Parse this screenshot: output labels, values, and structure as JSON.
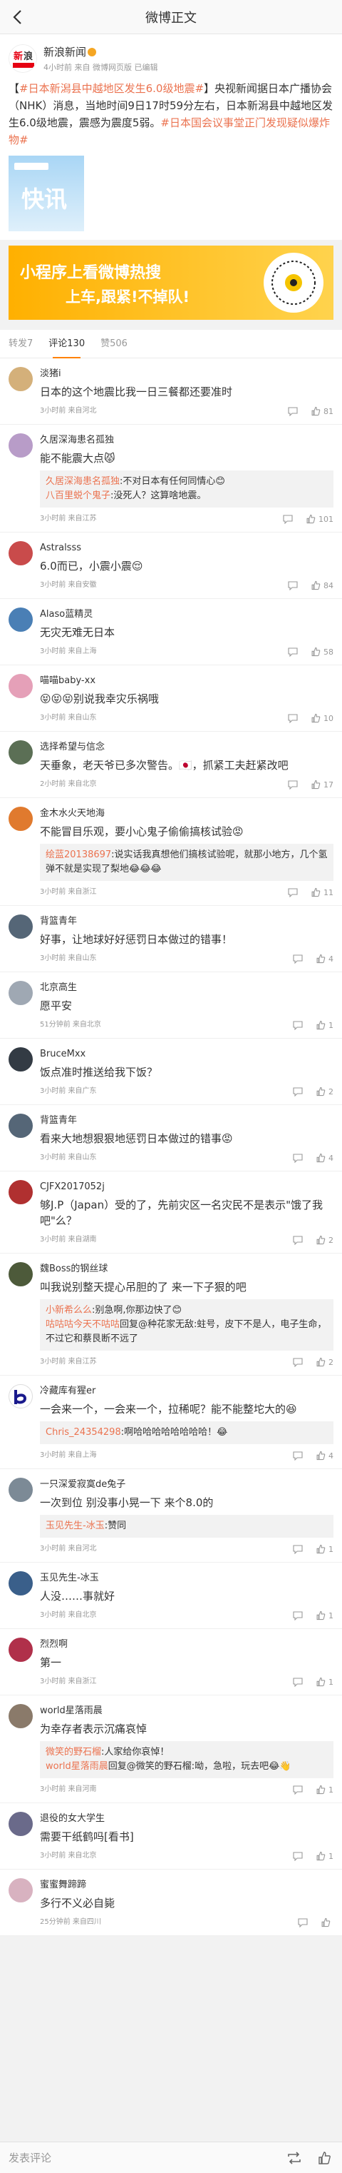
{
  "nav": {
    "title": "微博正文"
  },
  "post": {
    "author": "新浪新闻",
    "meta": "4小时前 来自 微博网页版 已编辑",
    "topic1": "#日本新潟县中越地区发生6.0级地震#",
    "text1": "央视新闻据日本广播协会（NHK）消息，当地时间9日17时59分左右，日本新潟县中越地区发生6.0级地震，震感为震度5弱。",
    "topic2": "#日本国会议事堂正门发现疑似爆炸物#",
    "image_label": "快讯"
  },
  "banner": {
    "line1": "小程序上看微博热搜",
    "line2": "上车,跟紧!不掉队!"
  },
  "tabs": [
    {
      "label": "转发7"
    },
    {
      "label": "评论130"
    },
    {
      "label": "赞506"
    }
  ],
  "comments": [
    {
      "name": "淡猪i",
      "text": "日本的这个地震比我一日三餐都还要准时",
      "meta": "3小时前 来自河北",
      "likes": "81",
      "avatar": "#d4b07a"
    },
    {
      "name": "久居深海患名孤独",
      "text": "能不能震大点😾",
      "reply_user": "久居深海患名孤独",
      "reply_text": ":不对日本有任何同情心😊",
      "reply2_user": "八百里蜕个鬼子",
      "reply2_text": ":没死人？这算啥地震。",
      "meta": "3小时前 来自江苏",
      "likes": "101",
      "avatar": "#b89cc8"
    },
    {
      "name": "Astralsss",
      "text": "6.0而已，小震小震😌",
      "meta": "3小时前 来自安徽",
      "likes": "84",
      "avatar": "#c94b4b"
    },
    {
      "name": "Alaso蓝精灵",
      "text": "无灾无难无日本",
      "meta": "3小时前 来自上海",
      "likes": "58",
      "avatar": "#4a7fb5"
    },
    {
      "name": "喵喵baby-xx",
      "text": "😝😝😝别说我幸灾乐祸哦",
      "meta": "3小时前 来自山东",
      "likes": "10",
      "avatar": "#e5a0b8"
    },
    {
      "name": "选择希望与信念",
      "text": "天垂象，老天爷已多次警告。🇯🇵，抓紧工夫赶紧改吧",
      "meta": "2小时前 来自北京",
      "likes": "17",
      "avatar": "#5b6f55"
    },
    {
      "name": "金木水火天地海",
      "text": "不能冒目乐观，要小心鬼子偷偷搞核试验😡",
      "reply_user": "绘蓝20138697",
      "reply_text": ":说实话我真想他们搞核试验呢，就那小地方，几个氢弹不就是实现了梨地😂😂😂",
      "meta": "3小时前 来自浙江",
      "likes": "11",
      "avatar": "#e07a2e"
    },
    {
      "name": "背篮青年",
      "text": "好事，让地球好好惩罚日本做过的错事！",
      "meta": "3小时前 来自山东",
      "likes": "4",
      "avatar": "#556677"
    },
    {
      "name": "北京高生",
      "text": "愿平安",
      "meta": "51分钟前 来自北京",
      "likes": "1",
      "avatar": "#9fa8b3"
    },
    {
      "name": "BruceMxx",
      "text": "饭点准时推送给我下饭？",
      "meta": "3小时前 来自广东",
      "likes": "2",
      "avatar": "#333b44"
    },
    {
      "name": "背篮青年",
      "text": "看来大地想狠狠地惩罚日本做过的错事😡",
      "meta": "3小时前 来自山东",
      "likes": "4",
      "avatar": "#556677"
    },
    {
      "name": "CJFX2017052j",
      "text": "够J.P（Japan）受的了，先前灾区一名灾民不是表示\"饿了我吧\"么？",
      "meta": "3小时前 来自湖南",
      "likes": "2",
      "avatar": "#b03030"
    },
    {
      "name": "魏Boss的钢丝球",
      "text": "叫我说别整天提心吊胆的了 来一下子狠的吧",
      "reply_user": "小新希么么",
      "reply_text": ":别急啊,你那边快了😊",
      "reply2_user": "咕咕咕今天不咕咕",
      "reply2_text": "回复@种花家无敌:蛀号，皮下不是人，电子生命，不过它和蔡艮断不远了",
      "meta": "3小时前 来自江苏",
      "likes": "2",
      "avatar": "#4d5a3a"
    },
    {
      "name": "冷藏库有猩er",
      "text": "一会来一个，一会来一个，拉稀呢？能不能整坨大的😆",
      "reply_user": "Chris_24354298",
      "reply_text": ":啊哈哈哈哈哈哈哈哈！😂",
      "meta": "3小时前 来自上海",
      "likes": "4",
      "avatar": "#ffffff"
    },
    {
      "name": "一只深爱寂寞de兔子",
      "text": "一次到位 别没事小晃一下 来个8.0的",
      "reply_user": "玉见先生-冰玉",
      "reply_text": ":赞同",
      "meta": "3小时前 来自河北",
      "likes": "1",
      "avatar": "#7c8a96"
    },
    {
      "name": "玉见先生-冰玉",
      "text": "人没……事就好",
      "meta": "3小时前 来自北京",
      "likes": "1",
      "avatar": "#3a5f8a"
    },
    {
      "name": "烈烈啊",
      "text": "第一",
      "meta": "3小时前 来自浙江",
      "likes": "1",
      "avatar": "#b0304a"
    },
    {
      "name": "world星落雨晨",
      "text": "为幸存者表示沉痛哀悼",
      "reply_user": "微笑的野石榴",
      "reply_text": ":人家给你哀悼！",
      "reply2_user": "world星落雨晨",
      "reply2_text": "回复@微笑的野石榴:呦，急啦，玩去吧😂👋",
      "meta": "3小时前 来自河南",
      "likes": "1",
      "avatar": "#8a7a6a"
    },
    {
      "name": "退役的女大学生",
      "text": "需要干纸鹤吗[看书]",
      "meta": "3小时前 来自北京",
      "likes": "1",
      "avatar": "#6a6a8a"
    },
    {
      "name": "蜜蜜舞蹄蹄",
      "text": "多行不义必自毙",
      "meta": "25分钟前 来自四川",
      "likes": "",
      "avatar": "#d8b2c0"
    }
  ],
  "bottom": {
    "placeholder": "发表评论"
  },
  "colors": {
    "accent": "#ff8200",
    "topic": "#eb7350"
  }
}
